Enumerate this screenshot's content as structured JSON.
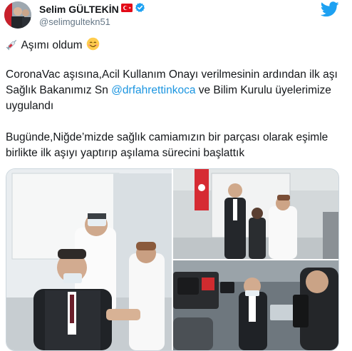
{
  "tweet": {
    "author_name": "Selim GÜLTEKİN",
    "author_handle": "@selimgultekn51",
    "line1": "Aşımı oldum",
    "para2_before": "CoronaVac aşısına,Acil Kullanım Onayı verilmesinin ardından ilk aşı Sağlık Bakanımız Sn ",
    "para2_mention": "@drfahrettinkoca",
    "para2_after": " ve Bilim Kurulu üyelerimize uygulandı",
    "para3": "Bugünde,Niğde’mizde sağlık camiamızın bir parçası olarak eşimle birlikte ilk aşıyı yaptırıp aşılama sürecini başlattık",
    "emoji_start": "syringe-emoji",
    "emoji_end": "smiling-face-emoji",
    "icons": [
      "flag-turkey-icon",
      "verified-badge-icon",
      "twitter-bird-icon"
    ],
    "colors": {
      "link": "#1b95e0",
      "brand": "#1da1f2",
      "secondary": "#657786"
    }
  }
}
